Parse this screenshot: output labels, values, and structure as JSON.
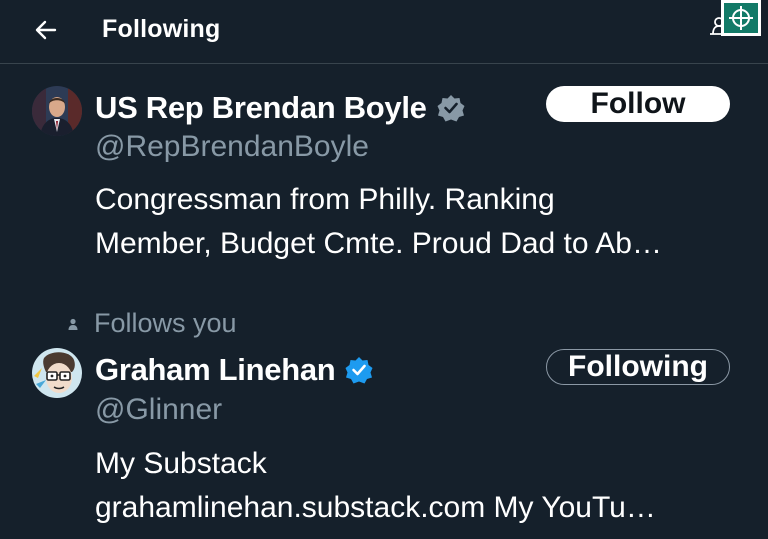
{
  "header": {
    "title": "Following"
  },
  "colors": {
    "background": "#15202b",
    "verified": "#1d9bf0",
    "secondary_text": "#8899a6"
  },
  "users": [
    {
      "display_name": "US Rep Brendan Boyle",
      "verified": true,
      "handle": "@RepBrendanBoyle",
      "bio": "Congressman from Philly. Ranking Member, Budget Cmte. Proud Dad to Ab…",
      "bio_lines": [
        "Congressman from Philly. Ranking",
        "Member, Budget Cmte. Proud Dad to Ab…"
      ],
      "button_label": "Follow",
      "avatar_icon": "avatar-photo"
    },
    {
      "follows_you_label": "Follows you",
      "display_name": "Graham Linehan",
      "verified": true,
      "handle": "@Glinner",
      "bio": "My Substack grahamlinehan.substack.com My YouTu…",
      "bio_lines": [
        "My Substack",
        "grahamlinehan.substack.com My YouTu…"
      ],
      "button_label": "Following",
      "avatar_icon": "avatar-cartoon"
    }
  ]
}
